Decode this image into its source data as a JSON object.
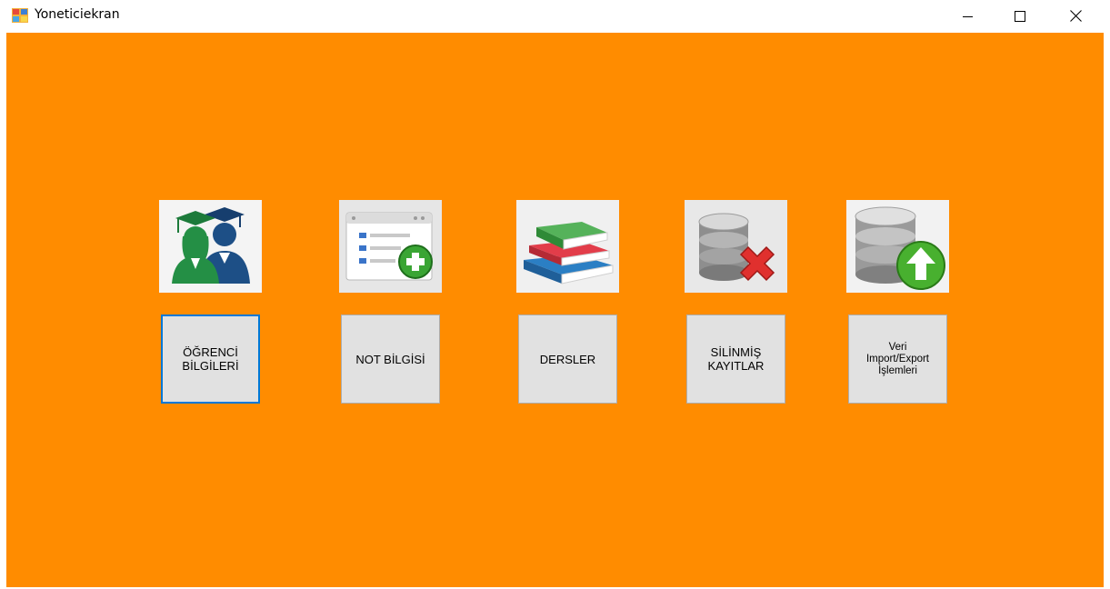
{
  "window": {
    "title": "Yoneticiekran",
    "icon": "form-icon"
  },
  "controls": {
    "minimize_icon": "minimize-icon",
    "maximize_icon": "maximize-icon",
    "close_icon": "close-icon"
  },
  "colors": {
    "background": "#ff8c00",
    "button_face": "#e1e1e1",
    "focus_border": "#0078d7"
  },
  "modules": [
    {
      "icon": "graduates-icon",
      "label": "ÖĞRENCİ\nBİLGİLERİ"
    },
    {
      "icon": "add-record-form-icon",
      "label": "NOT BİLGİSİ"
    },
    {
      "icon": "books-icon",
      "label": "DERSLER"
    },
    {
      "icon": "database-delete-icon",
      "label": "SİLİNMİŞ\nKAYITLAR"
    },
    {
      "icon": "database-upload-icon",
      "label": "Veri\nImport/Export\nİşlemleri"
    }
  ]
}
